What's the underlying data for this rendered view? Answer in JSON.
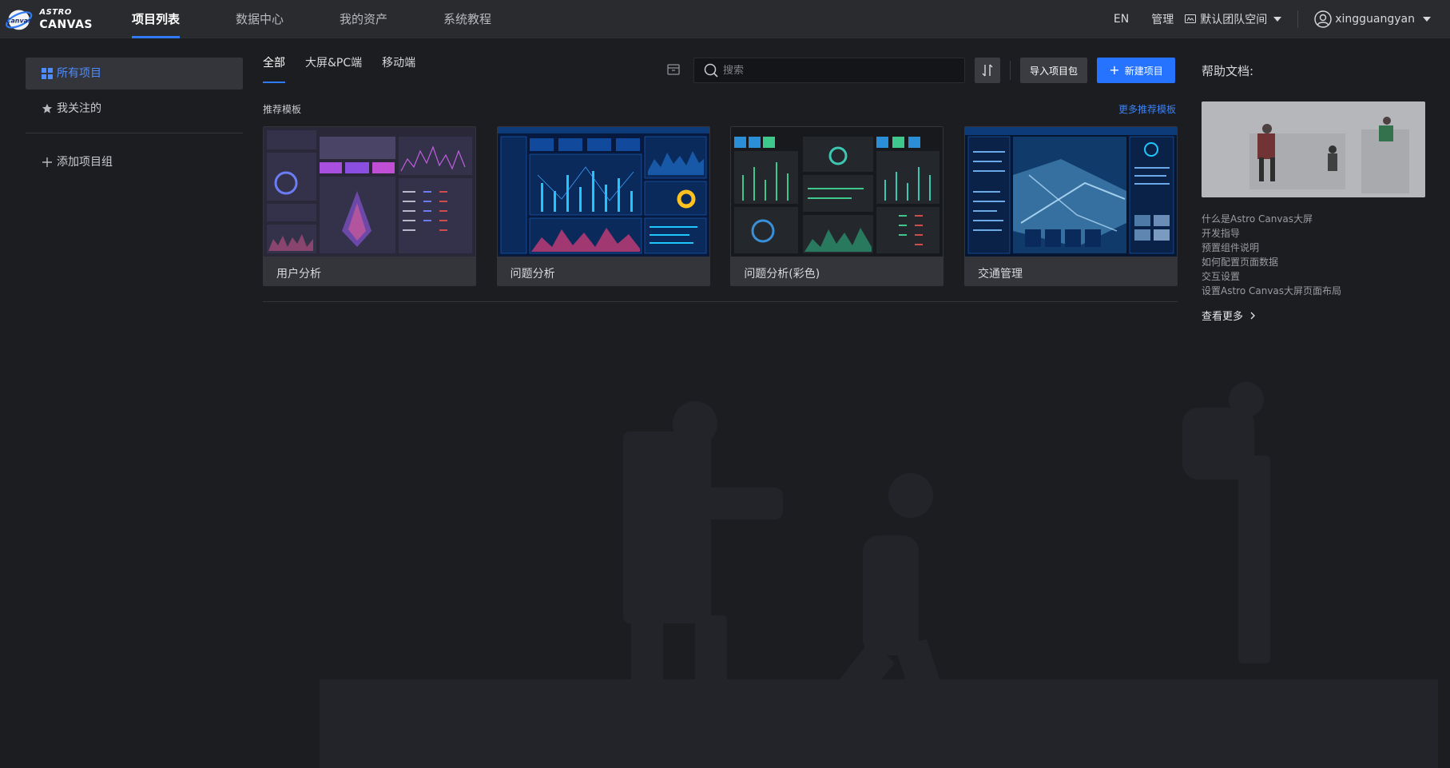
{
  "brand": {
    "line1": "ASTRO",
    "line2": "CANVAS"
  },
  "nav": {
    "items": [
      {
        "label": "项目列表",
        "active": true
      },
      {
        "label": "数据中心",
        "active": false
      },
      {
        "label": "我的资产",
        "active": false
      },
      {
        "label": "系统教程",
        "active": false
      }
    ]
  },
  "topright": {
    "lang": "EN",
    "manage": "管理",
    "team": "默认团队空间",
    "user": "xingguangyan"
  },
  "sidebar": {
    "all_projects": "所有项目",
    "followed": "我关注的",
    "add_group": "添加项目组"
  },
  "tabs": [
    "全部",
    "大屏&PC端",
    "移动端"
  ],
  "toolbar": {
    "search_placeholder": "搜索",
    "import_label": "导入项目包",
    "new_label": "新建项目"
  },
  "recommend": {
    "label": "推荐模板",
    "more": "更多推荐模板",
    "cards": [
      {
        "title": "用户分析"
      },
      {
        "title": "问题分析"
      },
      {
        "title": "问题分析(彩色)"
      },
      {
        "title": "交通管理"
      }
    ]
  },
  "help": {
    "title": "帮助文档:",
    "links": [
      "什么是Astro Canvas大屏",
      "开发指导",
      "预置组件说明",
      "如何配置页面数据",
      "交互设置",
      "设置Astro Canvas大屏页面布局"
    ],
    "more": "查看更多"
  },
  "colors": {
    "accent": "#2573ff",
    "bg": "#1c1d20",
    "topbar": "#2a2b2f"
  }
}
